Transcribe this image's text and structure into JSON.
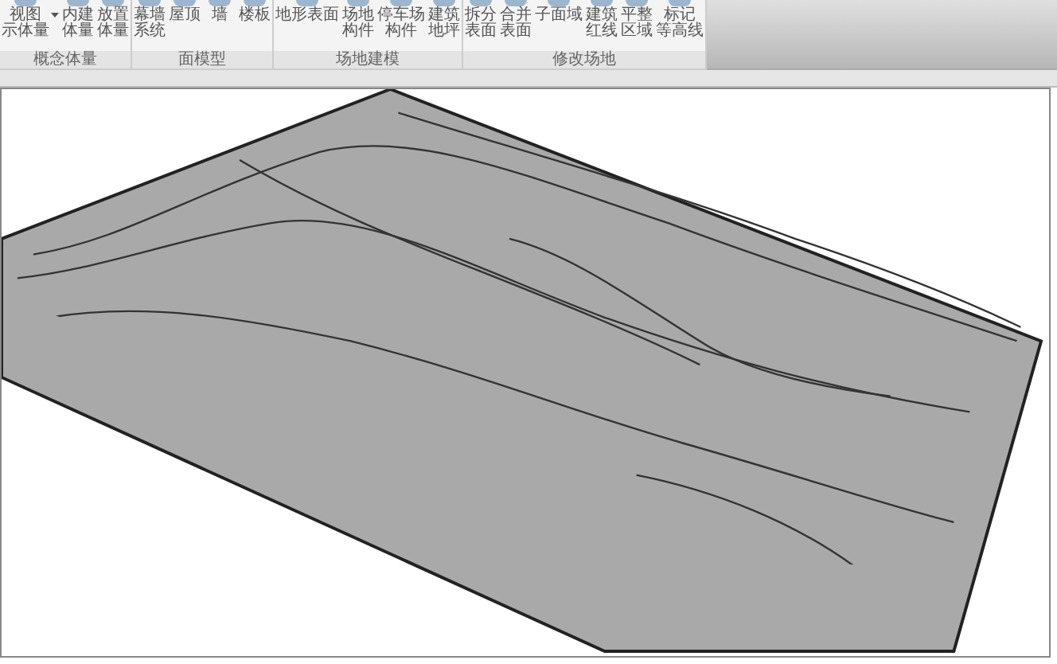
{
  "ribbon": {
    "panels": [
      {
        "title": "概念体量",
        "buttons": [
          {
            "lines": [
              "视图",
              "示体量"
            ],
            "dropdown": true
          },
          {
            "lines": [
              "内建",
              "体量"
            ],
            "dropdown": false
          },
          {
            "lines": [
              "放置",
              "体量"
            ],
            "dropdown": false
          }
        ]
      },
      {
        "title": "面模型",
        "buttons": [
          {
            "lines": [
              "幕墙",
              "系统"
            ],
            "dropdown": false
          },
          {
            "lines": [
              "屋顶"
            ],
            "dropdown": false
          },
          {
            "lines": [
              "墙"
            ],
            "dropdown": false
          },
          {
            "lines": [
              "楼板"
            ],
            "dropdown": false
          }
        ]
      },
      {
        "title": "场地建模",
        "buttons": [
          {
            "lines": [
              "地形表面"
            ],
            "dropdown": false
          },
          {
            "lines": [
              "场地",
              "构件"
            ],
            "dropdown": false
          },
          {
            "lines": [
              "停车场",
              "构件"
            ],
            "dropdown": false
          },
          {
            "lines": [
              "建筑",
              "地坪"
            ],
            "dropdown": false
          }
        ]
      },
      {
        "title": "修改场地",
        "buttons": [
          {
            "lines": [
              "拆分",
              "表面"
            ],
            "dropdown": false
          },
          {
            "lines": [
              "合并",
              "表面"
            ],
            "dropdown": false
          },
          {
            "lines": [
              "子面域"
            ],
            "dropdown": false
          },
          {
            "lines": [
              "建筑",
              "红线"
            ],
            "dropdown": false
          },
          {
            "lines": [
              "平整",
              "区域"
            ],
            "dropdown": false
          },
          {
            "lines": [
              "标记",
              "等高线"
            ],
            "dropdown": false
          }
        ]
      }
    ]
  }
}
